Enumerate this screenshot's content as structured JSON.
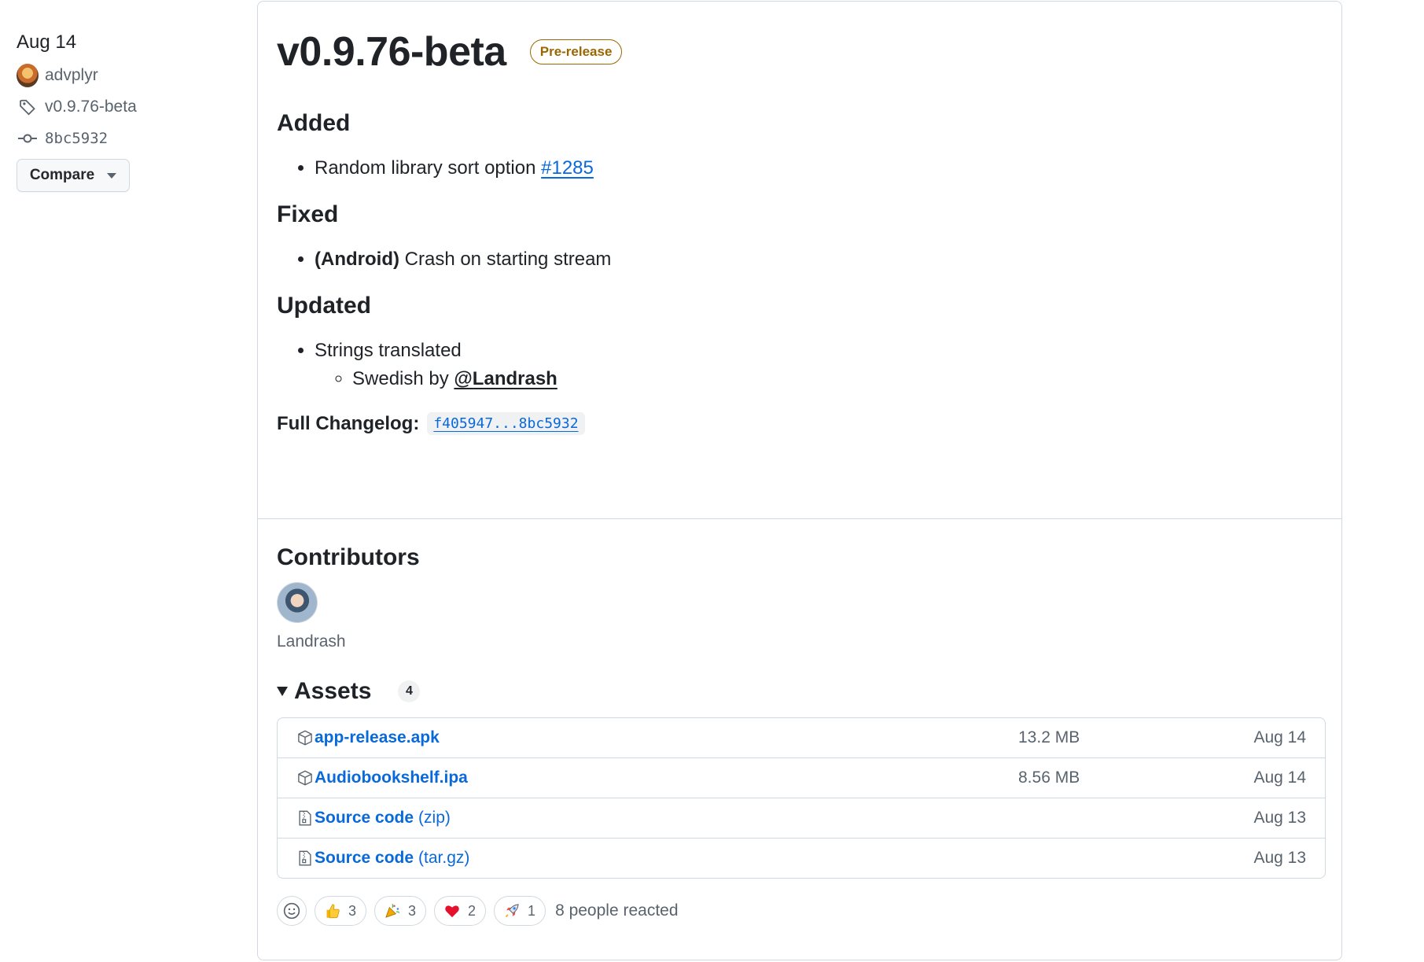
{
  "sidebar": {
    "date": "Aug 14",
    "author": "advplyr",
    "tag": "v0.9.76-beta",
    "commit": "8bc5932",
    "compare_label": "Compare"
  },
  "release": {
    "title": "v0.9.76-beta",
    "badge": "Pre-release",
    "sections": {
      "added": {
        "heading": "Added",
        "item_text": "Random library sort option",
        "item_link": "#1285"
      },
      "fixed": {
        "heading": "Fixed",
        "item_bold": "(Android)",
        "item_text": "Crash on starting stream"
      },
      "updated": {
        "heading": "Updated",
        "item_text": "Strings translated",
        "sub_text": "Swedish by",
        "sub_mention": "@Landrash"
      }
    },
    "changelog_label": "Full Changelog:",
    "changelog_range": "f405947...8bc5932"
  },
  "contributors": {
    "heading": "Contributors",
    "name": "Landrash"
  },
  "assets": {
    "heading": "Assets",
    "count": "4",
    "rows": [
      {
        "name": "app-release.apk",
        "ext": "",
        "size": "13.2 MB",
        "date": "Aug 14",
        "icon": "package-icon"
      },
      {
        "name": "Audiobookshelf.ipa",
        "ext": "",
        "size": "8.56 MB",
        "date": "Aug 14",
        "icon": "package-icon"
      },
      {
        "name": "Source code",
        "ext": "(zip)",
        "size": "",
        "date": "Aug 13",
        "icon": "file-zip-icon"
      },
      {
        "name": "Source code",
        "ext": "(tar.gz)",
        "size": "",
        "date": "Aug 13",
        "icon": "file-zip-icon"
      }
    ]
  },
  "reactions": {
    "thumbs_up": "3",
    "hooray": "3",
    "heart": "2",
    "rocket": "1",
    "summary": "8 people reacted"
  }
}
